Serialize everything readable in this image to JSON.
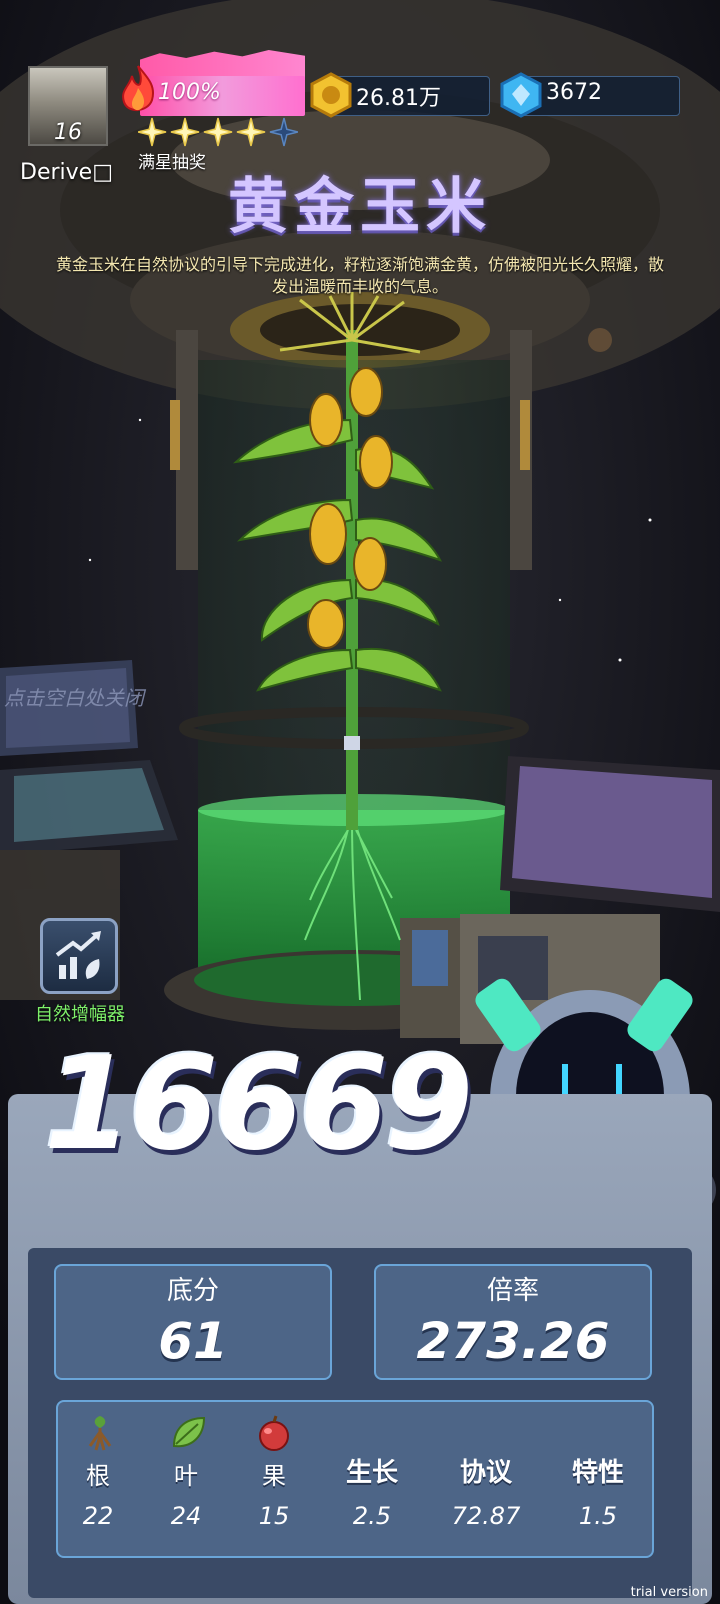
{
  "player": {
    "level": "16",
    "name": "Derive□"
  },
  "energy": {
    "percent_label": "100%",
    "level": 1.0,
    "stars_filled": 4,
    "stars_total": 5,
    "stars_label": "满星抽奖"
  },
  "currency": {
    "coins": "26.81万",
    "gems": "3672"
  },
  "item": {
    "title": "黄金玉米",
    "description": "黄金玉米在自然协议的引导下完成进化，籽粒逐渐饱满金黄，仿佛被阳光长久照耀，散发出温暖而丰收的气息。"
  },
  "hint": {
    "close": "点击空白处关闭"
  },
  "amplifier": {
    "label": "自然增幅器"
  },
  "score": {
    "total": "16669",
    "base_label": "底分",
    "base_value": "61",
    "multiplier_label": "倍率",
    "multiplier_value": "273.26"
  },
  "stats": [
    {
      "label": "根",
      "value": "22",
      "icon": "root-icon"
    },
    {
      "label": "叶",
      "value": "24",
      "icon": "leaf-icon"
    },
    {
      "label": "果",
      "value": "15",
      "icon": "fruit-icon"
    },
    {
      "label": "生长",
      "value": "2.5"
    },
    {
      "label": "协议",
      "value": "72.87"
    },
    {
      "label": "特性",
      "value": "1.5"
    }
  ],
  "colors": {
    "accent": "#6aa5d8",
    "title": "#d4c6ff",
    "amp": "#7ef06a",
    "energy": "#ff6fcf"
  },
  "watermark": "trial version"
}
